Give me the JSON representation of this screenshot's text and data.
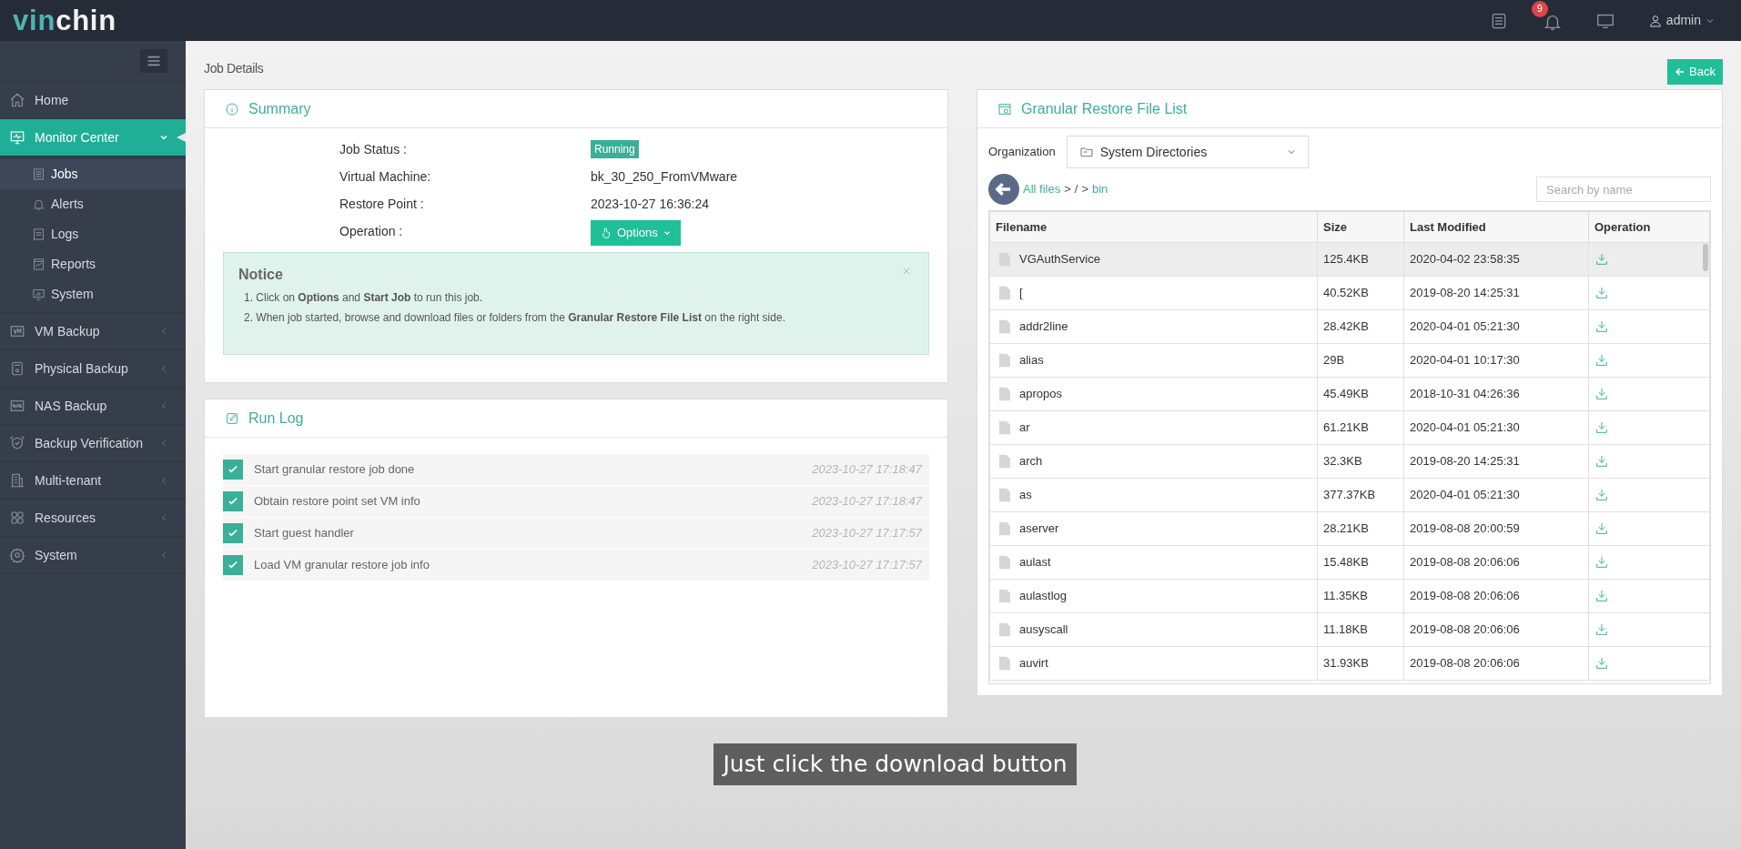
{
  "topbar": {
    "logo": {
      "accent": "vin",
      "text": "chin"
    },
    "notification_count": "9",
    "user": "admin"
  },
  "sidebar": {
    "items": [
      {
        "label": "Home",
        "selected": false
      },
      {
        "label": "Monitor Center",
        "selected": true,
        "expanded": true,
        "children": [
          {
            "label": "Jobs",
            "selected": true
          },
          {
            "label": "Alerts",
            "selected": false
          },
          {
            "label": "Logs",
            "selected": false
          },
          {
            "label": "Reports",
            "selected": false
          },
          {
            "label": "System",
            "selected": false
          }
        ]
      },
      {
        "label": "VM Backup",
        "selected": false,
        "expanded": false
      },
      {
        "label": "Physical Backup",
        "selected": false,
        "expanded": false
      },
      {
        "label": "NAS Backup",
        "selected": false,
        "expanded": false
      },
      {
        "label": "Backup Verification",
        "selected": false,
        "expanded": false
      },
      {
        "label": "Multi-tenant",
        "selected": false,
        "expanded": false
      },
      {
        "label": "Resources",
        "selected": false,
        "expanded": false
      },
      {
        "label": "System",
        "selected": false,
        "expanded": false
      }
    ]
  },
  "page_title": "Job Details",
  "back_button": "Back",
  "summary": {
    "title": "Summary",
    "fields": [
      {
        "label": "Job Status :",
        "kind": "badge",
        "value": "Running"
      },
      {
        "label": "Virtual Machine:",
        "kind": "text",
        "value": "bk_30_250_FromVMware"
      },
      {
        "label": "Restore Point :",
        "kind": "text",
        "value": "2023-10-27 16:36:24"
      },
      {
        "label": "Operation :",
        "kind": "button",
        "value": "Options"
      }
    ],
    "notice": {
      "title": "Notice",
      "items": [
        "1. Click on **Options** and **Start Job** to run this job.",
        "2. When job started, browse and download files or folders from the **Granular Restore File List** on the right side."
      ]
    }
  },
  "run_log": {
    "title": "Run Log",
    "entries": [
      {
        "text": "Start granular restore job done",
        "time": "2023-10-27 17:18:47",
        "checked": true
      },
      {
        "text": "Obtain restore point set VM info",
        "time": "2023-10-27 17:18:47",
        "checked": true
      },
      {
        "text": "Start guest handler",
        "time": "2023-10-27 17:17:57",
        "checked": true
      },
      {
        "text": "Load VM granular restore job info",
        "time": "2023-10-27 17:17:57",
        "checked": true
      }
    ]
  },
  "file_list": {
    "title": "Granular Restore File List",
    "organization_label": "Organization",
    "organization": "System Directories",
    "breadcrumb": [
      {
        "label": "All files",
        "link": true
      },
      {
        "label": ">",
        "link": false
      },
      {
        "label": "/",
        "link": false
      },
      {
        "label": ">",
        "link": false
      },
      {
        "label": "bin",
        "link": true
      }
    ],
    "search": {
      "placeholder": "Search by name"
    },
    "columns": [
      "Filename",
      "Size",
      "Last Modified",
      "Operation"
    ],
    "rows": [
      {
        "name": "VGAuthService",
        "size": "125.4KB",
        "modified": "2020-04-02 23:58:35",
        "highlighted": true
      },
      {
        "name": "[",
        "size": "40.52KB",
        "modified": "2019-08-20 14:25:31",
        "highlighted": false
      },
      {
        "name": "addr2line",
        "size": "28.42KB",
        "modified": "2020-04-01 05:21:30",
        "highlighted": false
      },
      {
        "name": "alias",
        "size": "29B",
        "modified": "2020-04-01 10:17:30",
        "highlighted": false
      },
      {
        "name": "apropos",
        "size": "45.49KB",
        "modified": "2018-10-31 04:26:36",
        "highlighted": false
      },
      {
        "name": "ar",
        "size": "61.21KB",
        "modified": "2020-04-01 05:21:30",
        "highlighted": false
      },
      {
        "name": "arch",
        "size": "32.3KB",
        "modified": "2019-08-20 14:25:31",
        "highlighted": false
      },
      {
        "name": "as",
        "size": "377.37KB",
        "modified": "2020-04-01 05:21:30",
        "highlighted": false
      },
      {
        "name": "aserver",
        "size": "28.21KB",
        "modified": "2019-08-08 20:00:59",
        "highlighted": false
      },
      {
        "name": "aulast",
        "size": "15.48KB",
        "modified": "2019-08-08 20:06:06",
        "highlighted": false
      },
      {
        "name": "aulastlog",
        "size": "11.35KB",
        "modified": "2019-08-08 20:06:06",
        "highlighted": false
      },
      {
        "name": "ausyscall",
        "size": "11.18KB",
        "modified": "2019-08-08 20:06:06",
        "highlighted": false
      },
      {
        "name": "auvirt",
        "size": "31.93KB",
        "modified": "2019-08-08 20:06:06",
        "highlighted": false
      }
    ]
  },
  "caption": "Just click the download button"
}
